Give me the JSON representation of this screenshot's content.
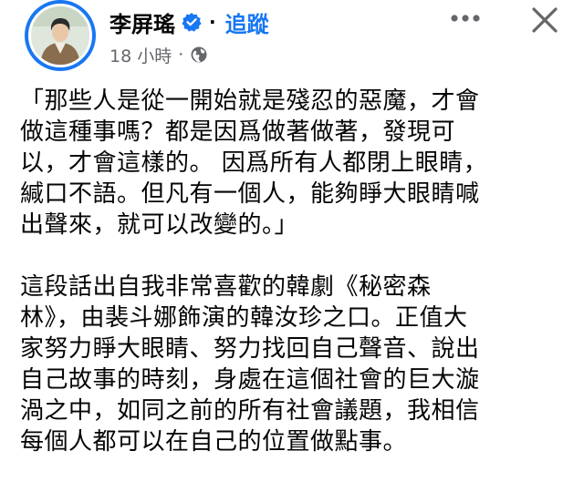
{
  "header": {
    "author_name": "李屏瑤",
    "verified_icon": "verified-badge-icon",
    "separator": "·",
    "follow_label": "追蹤",
    "time_label": "18 小時",
    "meta_separator": "·",
    "privacy_icon": "globe-icon",
    "more_icon": "more-horizontal-icon",
    "close_icon": "close-icon",
    "accent_color": "#1877f2",
    "secondary_text_color": "#65676b"
  },
  "post": {
    "paragraph_1": [
      "「那些人是從一開始就是殘忍的惡魔，才會",
      "做這種事嗎？都是因爲做著做著，發現可",
      "以，才會這樣的。 因爲所有人都閉上眼睛，",
      "緘口不語。但凡有一個人，能夠睜大眼睛喊",
      "出聲來，就可以改變的。」"
    ],
    "paragraph_2": [
      "這段話出自我非常喜歡的韓劇《秘密森",
      "林》，由裴斗娜飾演的韓汝珍之口。正值大",
      "家努力睜大眼睛、努力找回自己聲音、說出",
      "自己故事的時刻，身處在這個社會的巨大漩",
      "渦之中，如同之前的所有社會議題，我相信",
      "每個人都可以在自己的位置做點事。"
    ]
  }
}
